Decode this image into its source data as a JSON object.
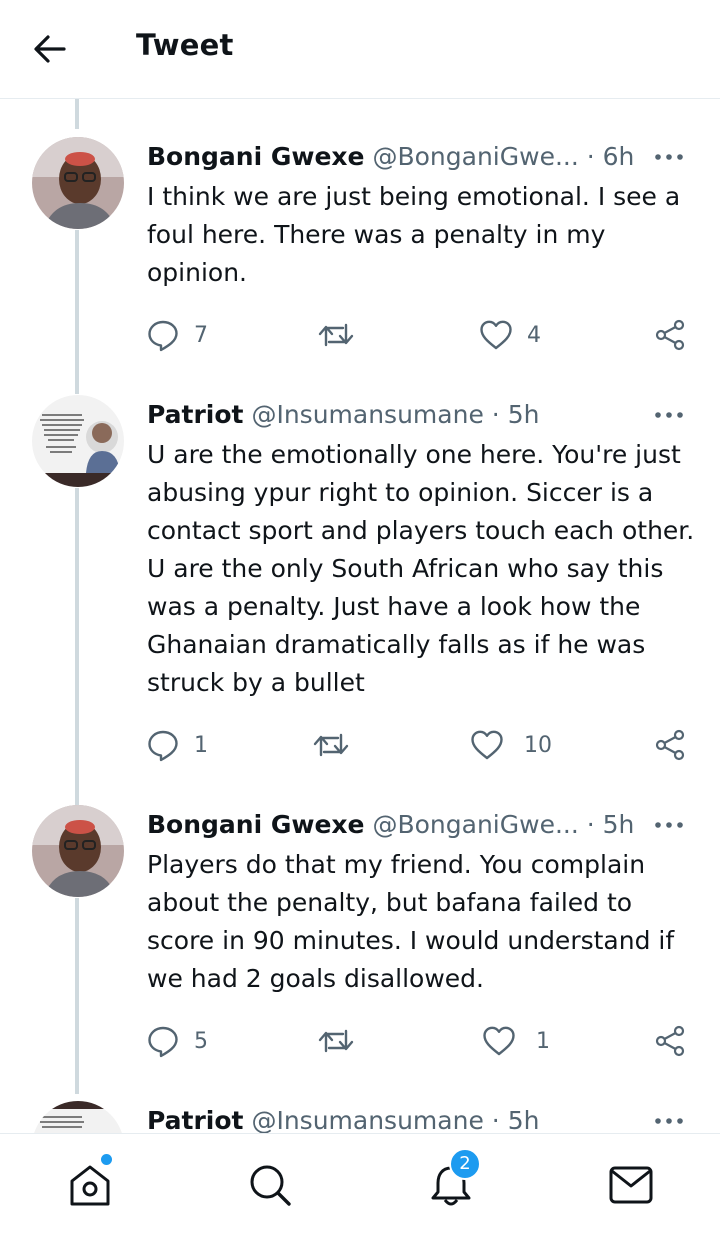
{
  "header": {
    "title": "Tweet"
  },
  "tweets": [
    {
      "name": "Bongani Gwexe",
      "handle": "@BonganiGwe...",
      "separator": "·",
      "time": "6h",
      "text": "I think we are just being emotional. I see a foul here. There was a penalty in my opinion.",
      "replies": "7",
      "retweets": "",
      "likes": "4",
      "avatar_text": ""
    },
    {
      "name": "Patriot",
      "handle": "@Insumansumane",
      "separator": "·",
      "time": "5h",
      "text": "U are the emotionally one here. You're just abusing ypur right to opinion. Siccer is a contact sport and players touch each other. U are the only South African who say this was a penalty. Just have a look how the Ghanaian dramatically falls as if he was struck by a bullet",
      "replies": "1",
      "retweets": "",
      "likes": "10",
      "avatar_text": "Only in Africa will thieves be regrouping to loot again and the youths whose future is being stolen will be celebrating it."
    },
    {
      "name": "Bongani Gwexe",
      "handle": "@BonganiGwe...",
      "separator": "·",
      "time": "5h",
      "text": "Players do that my friend. You complain about the penalty, but bafana failed to score in 90 minutes. I would understand if we had 2 goals disallowed.",
      "replies": "5",
      "retweets": "",
      "likes": "1",
      "avatar_text": ""
    },
    {
      "name": "Patriot",
      "handle": "@Insumansumane",
      "separator": "·",
      "time": "5h",
      "text": "",
      "avatar_text": "Only in Africa will thieves be regrouping to loot again"
    }
  ],
  "bottom_nav": {
    "items": [
      "home-icon",
      "search-icon",
      "notifications-icon",
      "messages-icon"
    ],
    "notifications_badge": "2",
    "accent": "#1d9bf0"
  }
}
